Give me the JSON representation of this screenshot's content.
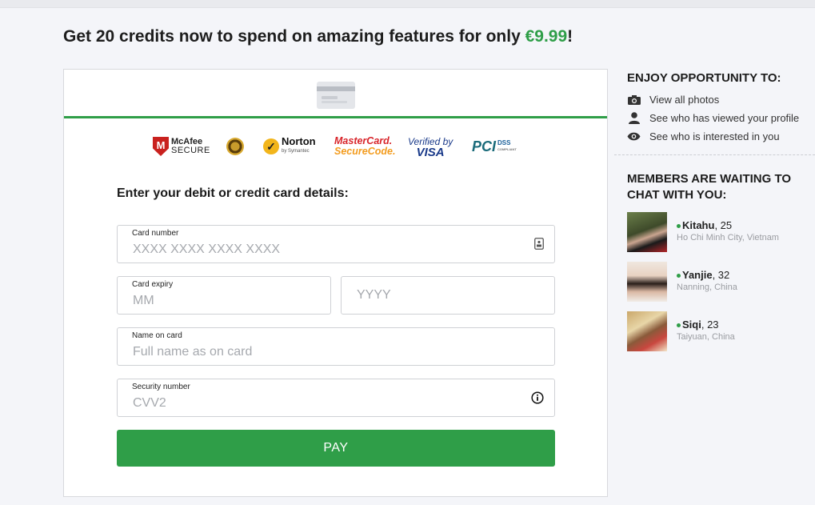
{
  "headline": {
    "text": "Get 20 credits now to spend on amazing features for only ",
    "price": "€9.99",
    "suffix": "!"
  },
  "trust_badges": {
    "mcafee": {
      "mark": "M",
      "name": "McAfee",
      "sub": "SECURE"
    },
    "norton": {
      "mark": "✓",
      "name": "Norton",
      "sub": "by Symantec"
    },
    "mastercard": {
      "line1": "MasterCard.",
      "line2": "SecureCode."
    },
    "visa": {
      "line1": "Verified by",
      "line2": "VISA"
    },
    "pci": {
      "mark": "PCI",
      "name": "DSS",
      "sub": "COMPLIANT"
    }
  },
  "form": {
    "title": "Enter your debit or credit card details:",
    "card_number": {
      "label": "Card number",
      "placeholder": "XXXX XXXX XXXX XXXX"
    },
    "card_expiry": {
      "label": "Card expiry",
      "month_placeholder": "MM",
      "year_placeholder": "YYYY"
    },
    "name_on_card": {
      "label": "Name on card",
      "placeholder": "Full name as on card"
    },
    "security_number": {
      "label": "Security number",
      "placeholder": "CVV2"
    },
    "pay_label": "PAY"
  },
  "sidebar": {
    "opportunity_title": "ENJOY OPPORTUNITY TO:",
    "opportunities": [
      {
        "icon": "camera-icon",
        "label": "View all photos"
      },
      {
        "icon": "person-icon",
        "label": "See who has viewed your profile"
      },
      {
        "icon": "eye-icon",
        "label": "See who is interested in you"
      }
    ],
    "members_title": "MEMBERS ARE WAITING TO CHAT WITH YOU:",
    "members": [
      {
        "name": "Kitahu",
        "age": ", 25",
        "location": "Ho Chi Minh City, Vietnam"
      },
      {
        "name": "Yanjie",
        "age": ", 32",
        "location": "Nanning, China"
      },
      {
        "name": "Siqi",
        "age": ", 23",
        "location": "Taiyuan, China"
      }
    ]
  },
  "colors": {
    "accent": "#2f9e48",
    "background": "#f4f5f9"
  }
}
